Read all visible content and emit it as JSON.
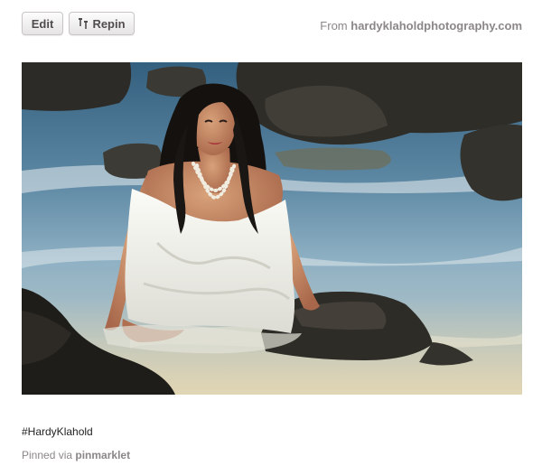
{
  "toolbar": {
    "edit_label": "Edit",
    "repin_label": "Repin",
    "repin_icon": "repin-icon"
  },
  "source": {
    "prefix": "From",
    "domain_name": "hardyklaholdphotography",
    "domain_suffix": ".com"
  },
  "photo": {
    "subject": "woman with wet dark hair and pearl necklace in white dress, kneeling in ocean surf among lava rocks"
  },
  "caption": {
    "text": "#HardyKlahold"
  },
  "pinned": {
    "prefix": "Pinned via",
    "app": "pinmarklet"
  },
  "colors": {
    "muted_text": "#8c8787",
    "button_text": "#524d4d",
    "body_text": "#222222"
  }
}
